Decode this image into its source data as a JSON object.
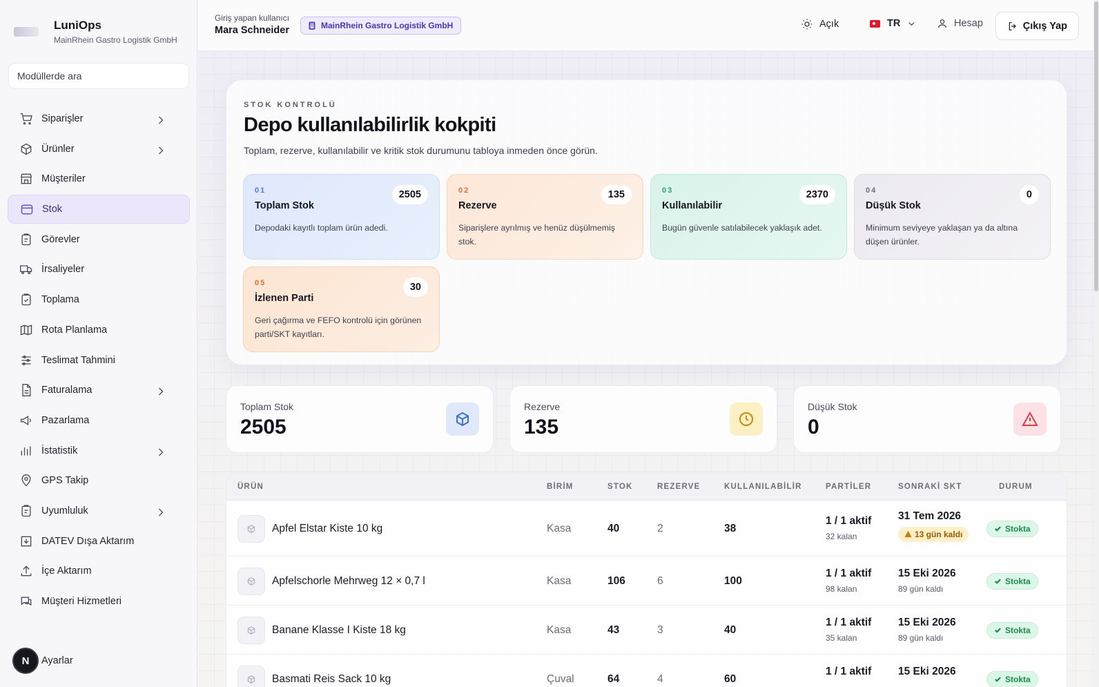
{
  "brand": {
    "title": "LuniOps",
    "subtitle": "MainRhein Gastro Logistik GmbH"
  },
  "search": {
    "placeholder": "Modüllerde ara"
  },
  "nav": [
    {
      "label": "Siparişler",
      "icon": "cart-icon",
      "chevron": true
    },
    {
      "label": "Ürünler",
      "icon": "box-icon",
      "chevron": true
    },
    {
      "label": "Müşteriler",
      "icon": "store-icon",
      "chevron": false
    },
    {
      "label": "Stok",
      "icon": "archive-icon",
      "chevron": false,
      "active": true
    },
    {
      "label": "Görevler",
      "icon": "clipboard-icon",
      "chevron": false
    },
    {
      "label": "İrsaliyeler",
      "icon": "truck-icon",
      "chevron": false
    },
    {
      "label": "Toplama",
      "icon": "clipboard-check-icon",
      "chevron": false
    },
    {
      "label": "Rota Planlama",
      "icon": "map-icon",
      "chevron": false
    },
    {
      "label": "Teslimat Tahmini",
      "icon": "sliders-icon",
      "chevron": false
    },
    {
      "label": "Faturalama",
      "icon": "file-icon",
      "chevron": true
    },
    {
      "label": "Pazarlama",
      "icon": "megaphone-icon",
      "chevron": false
    },
    {
      "label": "İstatistik",
      "icon": "bar-chart-icon",
      "chevron": true
    },
    {
      "label": "GPS Takip",
      "icon": "map-pin-icon",
      "chevron": false
    },
    {
      "label": "Uyumluluk",
      "icon": "clipboard-icon",
      "chevron": true
    },
    {
      "label": "DATEV Dışa Aktarım",
      "icon": "download-icon",
      "chevron": false
    },
    {
      "label": "İçe Aktarım",
      "icon": "upload-icon",
      "chevron": false
    },
    {
      "label": "Müşteri Hizmetleri",
      "icon": "chat-icon",
      "chevron": false
    }
  ],
  "settings": {
    "badge": "N",
    "label": "Ayarlar"
  },
  "header": {
    "user_label": "Giriş yapan kullanıcı",
    "user_name": "Mara Schneider",
    "company": "MainRhein Gastro Logistik GmbH",
    "theme": "Açık",
    "lang": "TR",
    "account": "Hesap",
    "logout": "Çıkış Yap"
  },
  "hero": {
    "eyebrow": "STOK KONTROLÜ",
    "title": "Depo kullanılabilirlik kokpiti",
    "desc": "Toplam, rezerve, kullanılabilir ve kritik stok durumunu tabloya inmeden önce görün.",
    "cards": [
      {
        "num": "01",
        "title": "Toplam Stok",
        "value": "2505",
        "desc": "Depodaki kayıtlı toplam ürün adedi."
      },
      {
        "num": "02",
        "title": "Rezerve",
        "value": "135",
        "desc": "Siparişlere ayrılmış ve henüz düşülmemiş stok."
      },
      {
        "num": "03",
        "title": "Kullanılabilir",
        "value": "2370",
        "desc": "Bugün güvenle satılabilecek yaklaşık adet."
      },
      {
        "num": "04",
        "title": "Düşük Stok",
        "value": "0",
        "desc": "Minimum seviyeye yaklaşan ya da altına düşen ürünler."
      },
      {
        "num": "05",
        "title": "İzlenen Parti",
        "value": "30",
        "desc": "Geri çağırma ve FEFO kontrolü için görünen parti/SKT kayıtları."
      }
    ]
  },
  "stats": [
    {
      "label": "Toplam Stok",
      "value": "2505",
      "icon": "box-icon",
      "color": "#3b6fd8",
      "bg": "#dfe9fb"
    },
    {
      "label": "Rezerve",
      "value": "135",
      "icon": "clock-icon",
      "color": "#c98a0a",
      "bg": "#fdf0c4"
    },
    {
      "label": "Düşük Stok",
      "value": "0",
      "icon": "alert-triangle-icon",
      "color": "#d83b4a",
      "bg": "#fde1e4"
    }
  ],
  "table": {
    "headers": [
      "ÜRÜN",
      "BİRİM",
      "STOK",
      "REZERVE",
      "KULLANILABİLİR",
      "PARTİLER",
      "SONRAKİ SKT",
      "DURUM"
    ],
    "rows": [
      {
        "product": "Apfel Elstar Kiste 10 kg",
        "unit": "Kasa",
        "stock": "40",
        "reserved": "2",
        "available": "38",
        "lots": "1 / 1 aktif",
        "lots_sub": "32 kalan",
        "skt": "31 Tem 2026",
        "skt_sub": "13 gün kaldı",
        "skt_warn": true,
        "status": "Stokta"
      },
      {
        "product": "Apfelschorle Mehrweg 12 × 0,7 l",
        "unit": "Kasa",
        "stock": "106",
        "reserved": "6",
        "available": "100",
        "lots": "1 / 1 aktif",
        "lots_sub": "98 kalan",
        "skt": "15 Eki 2026",
        "skt_sub": "89 gün kaldı",
        "skt_warn": false,
        "status": "Stokta"
      },
      {
        "product": "Banane Klasse I Kiste 18 kg",
        "unit": "Kasa",
        "stock": "43",
        "reserved": "3",
        "available": "40",
        "lots": "1 / 1 aktif",
        "lots_sub": "35 kalan",
        "skt": "15 Eki 2026",
        "skt_sub": "89 gün kaldı",
        "skt_warn": false,
        "status": "Stokta"
      },
      {
        "product": "Basmati Reis Sack 10 kg",
        "unit": "Çuval",
        "stock": "64",
        "reserved": "4",
        "available": "60",
        "lots": "1 / 1 aktif",
        "lots_sub": "",
        "skt": "15 Eki 2026",
        "skt_sub": "",
        "skt_warn": false,
        "status": "Stokta"
      }
    ]
  }
}
